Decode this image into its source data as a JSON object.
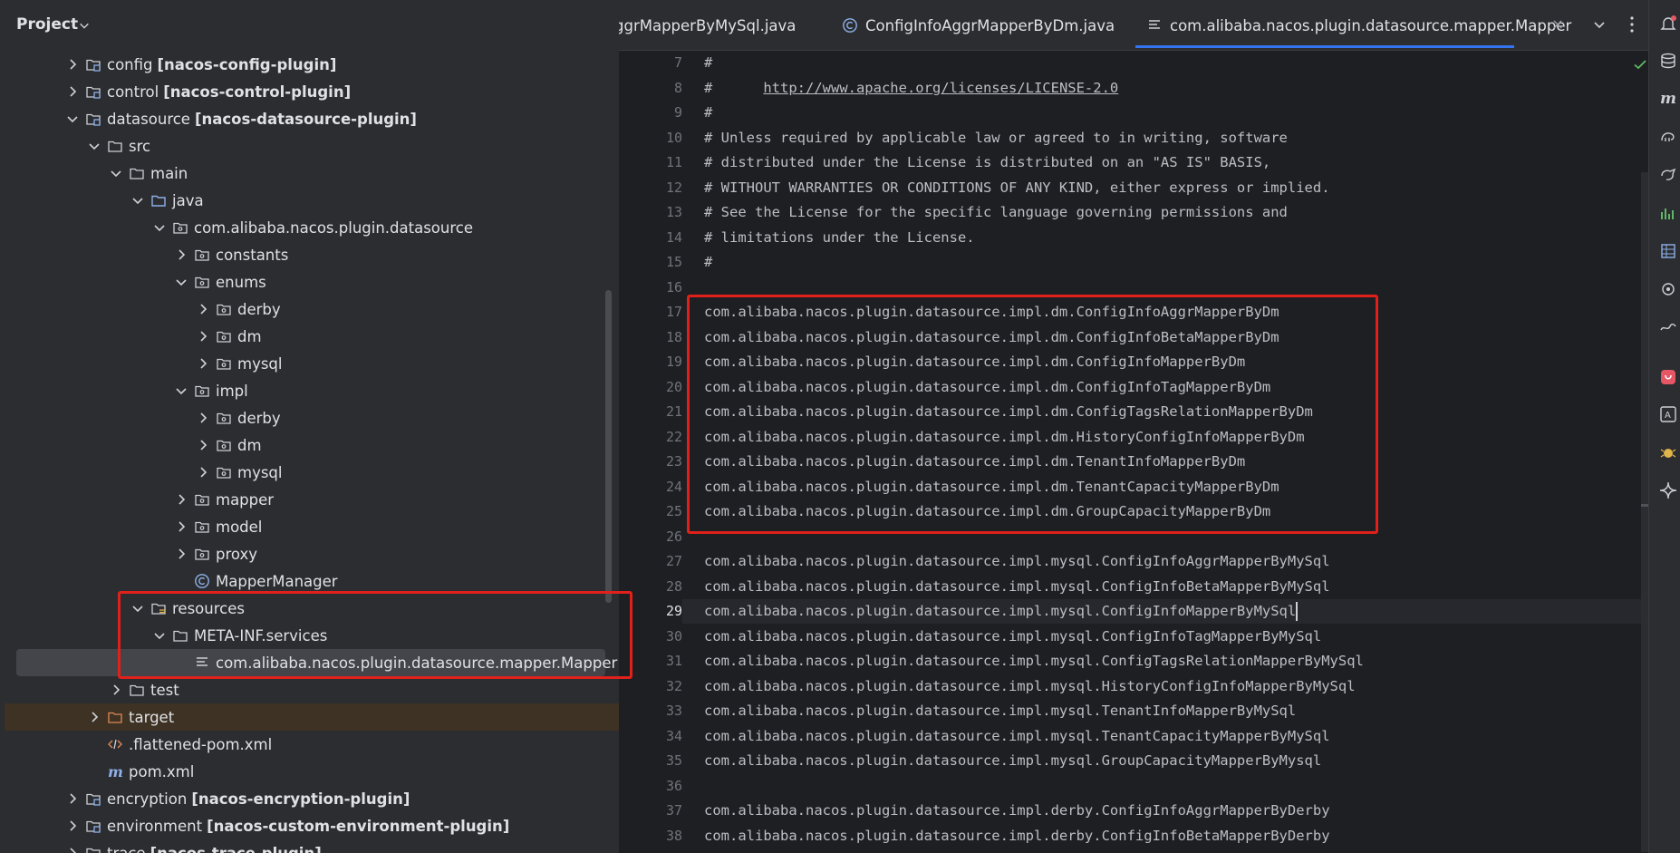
{
  "project_panel": {
    "title": "Project",
    "tree": [
      {
        "indent": 0,
        "chevron": "right",
        "icon": "module-folder",
        "label": "config",
        "module": "[nacos-config-plugin]"
      },
      {
        "indent": 0,
        "chevron": "right",
        "icon": "module-folder",
        "label": "control",
        "module": "[nacos-control-plugin]"
      },
      {
        "indent": 0,
        "chevron": "down",
        "icon": "module-folder",
        "label": "datasource",
        "module": "[nacos-datasource-plugin]"
      },
      {
        "indent": 1,
        "chevron": "down",
        "icon": "folder",
        "label": "src"
      },
      {
        "indent": 2,
        "chevron": "down",
        "icon": "folder",
        "label": "main"
      },
      {
        "indent": 3,
        "chevron": "down",
        "icon": "source-folder",
        "label": "java"
      },
      {
        "indent": 4,
        "chevron": "down",
        "icon": "package",
        "label": "com.alibaba.nacos.plugin.datasource"
      },
      {
        "indent": 5,
        "chevron": "right",
        "icon": "package",
        "label": "constants"
      },
      {
        "indent": 5,
        "chevron": "down",
        "icon": "package",
        "label": "enums"
      },
      {
        "indent": 6,
        "chevron": "right",
        "icon": "package",
        "label": "derby"
      },
      {
        "indent": 6,
        "chevron": "right",
        "icon": "package",
        "label": "dm"
      },
      {
        "indent": 6,
        "chevron": "right",
        "icon": "package",
        "label": "mysql"
      },
      {
        "indent": 5,
        "chevron": "down",
        "icon": "package",
        "label": "impl"
      },
      {
        "indent": 6,
        "chevron": "right",
        "icon": "package",
        "label": "derby"
      },
      {
        "indent": 6,
        "chevron": "right",
        "icon": "package",
        "label": "dm"
      },
      {
        "indent": 6,
        "chevron": "right",
        "icon": "package",
        "label": "mysql"
      },
      {
        "indent": 5,
        "chevron": "right",
        "icon": "package",
        "label": "mapper"
      },
      {
        "indent": 5,
        "chevron": "right",
        "icon": "package",
        "label": "model"
      },
      {
        "indent": 5,
        "chevron": "right",
        "icon": "package",
        "label": "proxy"
      },
      {
        "indent": 5,
        "chevron": "none",
        "icon": "class",
        "label": "MapperManager"
      },
      {
        "indent": 3,
        "chevron": "down",
        "icon": "resources-folder",
        "label": "resources"
      },
      {
        "indent": 4,
        "chevron": "down",
        "icon": "folder",
        "label": "META-INF.services"
      },
      {
        "indent": 5,
        "chevron": "none",
        "icon": "text-file",
        "label": "com.alibaba.nacos.plugin.datasource.mapper.Mapper",
        "selected": true
      },
      {
        "indent": 2,
        "chevron": "right",
        "icon": "folder",
        "label": "test"
      },
      {
        "indent": 1,
        "chevron": "right",
        "icon": "excluded-folder",
        "label": "target",
        "excluded": true
      },
      {
        "indent": 1,
        "chevron": "none",
        "icon": "xml-file",
        "label": ".flattened-pom.xml"
      },
      {
        "indent": 1,
        "chevron": "none",
        "icon": "maven-file",
        "label": "pom.xml"
      },
      {
        "indent": 0,
        "chevron": "right",
        "icon": "module-folder",
        "label": "encryption",
        "module": "[nacos-encryption-plugin]"
      },
      {
        "indent": 0,
        "chevron": "right",
        "icon": "module-folder",
        "label": "environment",
        "module": "[nacos-custom-environment-plugin]"
      },
      {
        "indent": 0,
        "chevron": "right",
        "icon": "module-folder",
        "label": "trace",
        "module": "[nacos-trace-plugin]"
      }
    ]
  },
  "editor": {
    "tabs": [
      {
        "label": "ggrMapperByMySql.java",
        "icon": "none"
      },
      {
        "label": "ConfigInfoAggrMapperByDm.java",
        "icon": "class-icon"
      },
      {
        "label": "com.alibaba.nacos.plugin.datasource.mapper.Mapper",
        "icon": "text-file-icon",
        "active": true
      }
    ],
    "current_line": 29,
    "lines": [
      {
        "n": 7,
        "text": "#"
      },
      {
        "n": 8,
        "text": "#      ",
        "link": "http://www.apache.org/licenses/LICENSE-2.0"
      },
      {
        "n": 9,
        "text": "#"
      },
      {
        "n": 10,
        "text": "# Unless required by applicable law or agreed to in writing, software"
      },
      {
        "n": 11,
        "text": "# distributed under the License is distributed on an \"AS IS\" BASIS,"
      },
      {
        "n": 12,
        "text": "# WITHOUT WARRANTIES OR CONDITIONS OF ANY KIND, either express or implied."
      },
      {
        "n": 13,
        "text": "# See the License for the specific language governing permissions and"
      },
      {
        "n": 14,
        "text": "# limitations under the License."
      },
      {
        "n": 15,
        "text": "#"
      },
      {
        "n": 16,
        "text": ""
      },
      {
        "n": 17,
        "text": "com.alibaba.nacos.plugin.datasource.impl.dm.ConfigInfoAggrMapperByDm"
      },
      {
        "n": 18,
        "text": "com.alibaba.nacos.plugin.datasource.impl.dm.ConfigInfoBetaMapperByDm"
      },
      {
        "n": 19,
        "text": "com.alibaba.nacos.plugin.datasource.impl.dm.ConfigInfoMapperByDm"
      },
      {
        "n": 20,
        "text": "com.alibaba.nacos.plugin.datasource.impl.dm.ConfigInfoTagMapperByDm"
      },
      {
        "n": 21,
        "text": "com.alibaba.nacos.plugin.datasource.impl.dm.ConfigTagsRelationMapperByDm"
      },
      {
        "n": 22,
        "text": "com.alibaba.nacos.plugin.datasource.impl.dm.HistoryConfigInfoMapperByDm"
      },
      {
        "n": 23,
        "text": "com.alibaba.nacos.plugin.datasource.impl.dm.TenantInfoMapperByDm"
      },
      {
        "n": 24,
        "text": "com.alibaba.nacos.plugin.datasource.impl.dm.TenantCapacityMapperByDm"
      },
      {
        "n": 25,
        "text": "com.alibaba.nacos.plugin.datasource.impl.dm.GroupCapacityMapperByDm"
      },
      {
        "n": 26,
        "text": ""
      },
      {
        "n": 27,
        "text": "com.alibaba.nacos.plugin.datasource.impl.mysql.ConfigInfoAggrMapperByMySql"
      },
      {
        "n": 28,
        "text": "com.alibaba.nacos.plugin.datasource.impl.mysql.ConfigInfoBetaMapperByMySql"
      },
      {
        "n": 29,
        "text": "com.alibaba.nacos.plugin.datasource.impl.mysql.ConfigInfoMapperByMySql"
      },
      {
        "n": 30,
        "text": "com.alibaba.nacos.plugin.datasource.impl.mysql.ConfigInfoTagMapperByMySql"
      },
      {
        "n": 31,
        "text": "com.alibaba.nacos.plugin.datasource.impl.mysql.ConfigTagsRelationMapperByMySql"
      },
      {
        "n": 32,
        "text": "com.alibaba.nacos.plugin.datasource.impl.mysql.HistoryConfigInfoMapperByMySql"
      },
      {
        "n": 33,
        "text": "com.alibaba.nacos.plugin.datasource.impl.mysql.TenantInfoMapperByMySql"
      },
      {
        "n": 34,
        "text": "com.alibaba.nacos.plugin.datasource.impl.mysql.TenantCapacityMapperByMySql"
      },
      {
        "n": 35,
        "text": "com.alibaba.nacos.plugin.datasource.impl.mysql.GroupCapacityMapperByMysql"
      },
      {
        "n": 36,
        "text": ""
      },
      {
        "n": 37,
        "text": "com.alibaba.nacos.plugin.datasource.impl.derby.ConfigInfoAggrMapperByDerby"
      },
      {
        "n": 38,
        "text": "com.alibaba.nacos.plugin.datasource.impl.derby.ConfigInfoBetaMapperByDerby"
      }
    ]
  },
  "right_strip": {
    "icons": [
      "notifications-icon",
      "database-icon",
      "maven-icon",
      "gradle-icon",
      "ai-assistant-icon",
      "profiler-icon",
      "structure-icon",
      "services-icon",
      "endpoints-icon",
      "plugin-red-icon",
      "translate-icon",
      "bug-icon",
      "gemini-icon"
    ]
  },
  "colors": {
    "panel_bg": "#2b2d30",
    "editor_bg": "#1e1f22",
    "highlight_red": "#e0201a",
    "accent_blue": "#3574f0",
    "folder_icon": "#8fb0e8",
    "success_green": "#5fb865"
  }
}
